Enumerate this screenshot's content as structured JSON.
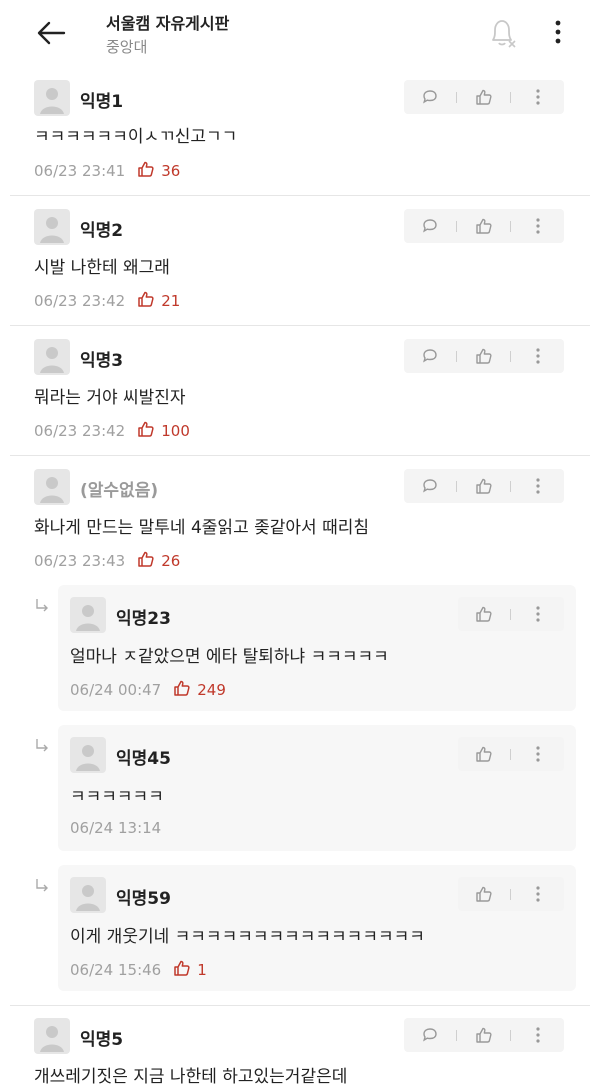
{
  "header": {
    "title": "서울캠 자유게시판",
    "subtitle": "중앙대",
    "icons": [
      "back-arrow-icon",
      "bell-off-icon",
      "more-vertical-icon"
    ]
  },
  "colors": {
    "like": "#c0392b",
    "meta": "#a0a0a0",
    "action_bg": "#f4f4f4"
  },
  "comments": [
    {
      "author": "익명1",
      "text": "ㅋㅋㅋㅋㅋㅋ이ㅅㄲ신고ㄱㄱ",
      "time": "06/23 23:41",
      "likes": "36"
    },
    {
      "author": "익명2",
      "text": "시발 나한테 왜그래",
      "time": "06/23 23:42",
      "likes": "21"
    },
    {
      "author": "익명3",
      "text": "뭐라는 거야 씨발진자",
      "time": "06/23 23:42",
      "likes": "100"
    },
    {
      "author": "(알수없음)",
      "text": "화나게 만드는 말투네 4줄읽고 좆같아서 때리침",
      "time": "06/23 23:43",
      "likes": "26"
    },
    {
      "author": "익명5",
      "text": "개쓰레기짓은 지금 나한테 하고있는거같은데",
      "time": "",
      "likes": ""
    }
  ],
  "replies": [
    {
      "author": "익명23",
      "text": "얼마나 ㅈ같았으면 에타 탈퇴하냐 ㅋㅋㅋㅋㅋ",
      "time": "06/24 00:47",
      "likes": "249"
    },
    {
      "author": "익명45",
      "text": "ㅋㅋㅋㅋㅋㅋ",
      "time": "06/24 13:14",
      "likes": ""
    },
    {
      "author": "익명59",
      "text": "이게 개웃기네 ㅋㅋㅋㅋㅋㅋㅋㅋㅋㅋㅋㅋㅋㅋㅋㅋ",
      "time": "06/24 15:46",
      "likes": "1"
    }
  ]
}
